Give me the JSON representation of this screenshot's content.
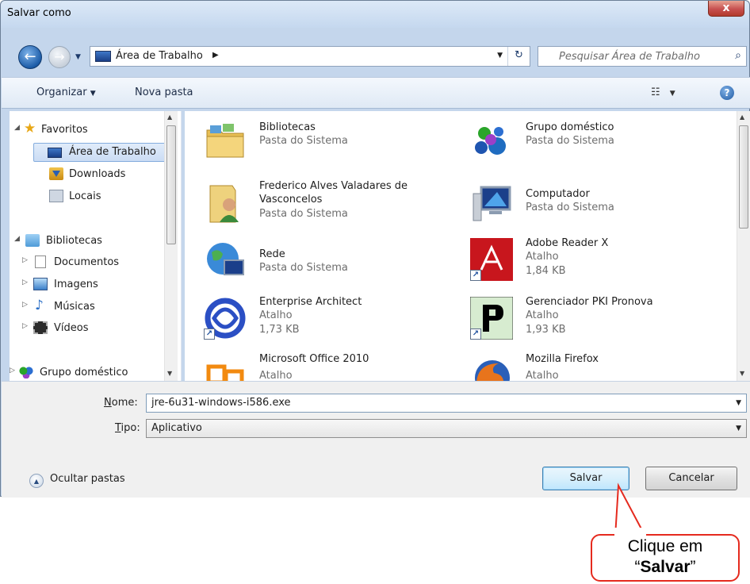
{
  "window": {
    "title": "Salvar como",
    "close_label": "x"
  },
  "address": {
    "crumb": "Área de Trabalho"
  },
  "search": {
    "placeholder": "Pesquisar Área de Trabalho"
  },
  "toolbar": {
    "organize": "Organizar",
    "new_folder": "Nova pasta"
  },
  "nav": {
    "favorites": "Favoritos",
    "desktop": "Área de Trabalho",
    "downloads": "Downloads",
    "places": "Locais",
    "libraries": "Bibliotecas",
    "documents": "Documentos",
    "images": "Imagens",
    "music": "Músicas",
    "videos": "Vídeos",
    "homegroup": "Grupo doméstico"
  },
  "items": [
    {
      "name": "Bibliotecas",
      "type": "Pasta do Sistema",
      "size": ""
    },
    {
      "name": "Grupo doméstico",
      "type": "Pasta do Sistema",
      "size": ""
    },
    {
      "name": "Frederico Alves Valadares de Vasconcelos",
      "type": "Pasta do Sistema",
      "size": ""
    },
    {
      "name": "Computador",
      "type": "Pasta do Sistema",
      "size": ""
    },
    {
      "name": "Rede",
      "type": "Pasta do Sistema",
      "size": ""
    },
    {
      "name": "Adobe Reader X",
      "type": "Atalho",
      "size": "1,84 KB"
    },
    {
      "name": "Enterprise Architect",
      "type": "Atalho",
      "size": "1,73 KB"
    },
    {
      "name": "Gerenciador PKI Pronova",
      "type": "Atalho",
      "size": "1,93 KB"
    },
    {
      "name": "Microsoft Office 2010",
      "type": "Atalho",
      "size": ""
    },
    {
      "name": "Mozilla Firefox",
      "type": "Atalho",
      "size": ""
    }
  ],
  "form": {
    "name_label_u": "N",
    "name_label_rest": "ome:",
    "name_value": "jre-6u31-windows-i586.exe",
    "type_label_u": "T",
    "type_label_rest": "ipo:",
    "type_value": "Aplicativo"
  },
  "footer": {
    "hide_folders": "Ocultar pastas",
    "save": "Salvar",
    "cancel": "Cancelar"
  },
  "callout": {
    "line1": "Clique em",
    "quote_open": "“",
    "bold": "Salvar",
    "quote_close": "”"
  },
  "colors": {
    "callout_border": "#e52a1e",
    "accent": "#1c5ca8"
  }
}
